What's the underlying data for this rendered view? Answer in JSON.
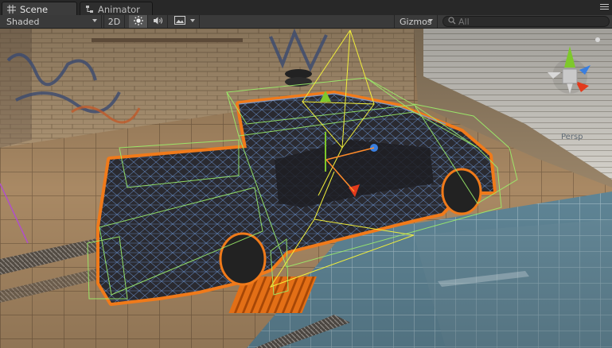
{
  "tabs": [
    {
      "label": "Scene",
      "icon": "grid-icon",
      "active": true
    },
    {
      "label": "Animator",
      "icon": "animator-icon",
      "active": false
    }
  ],
  "toolbar": {
    "shading_mode": "Shaded",
    "mode_2d_label": "2D",
    "lighting_icon": "sun-icon",
    "audio_icon": "speaker-icon",
    "effects_icon": "image-icon",
    "gizmos_label": "Gizmos",
    "search_placeholder": "All"
  },
  "viewport": {
    "projection_label": "Persp",
    "axis_colors": {
      "x": "#e23a1c",
      "y": "#7ec82b",
      "z": "#3a7fe0"
    },
    "selection_outline_color": "#f07a1a",
    "bounds_color": "#9cf06a"
  }
}
